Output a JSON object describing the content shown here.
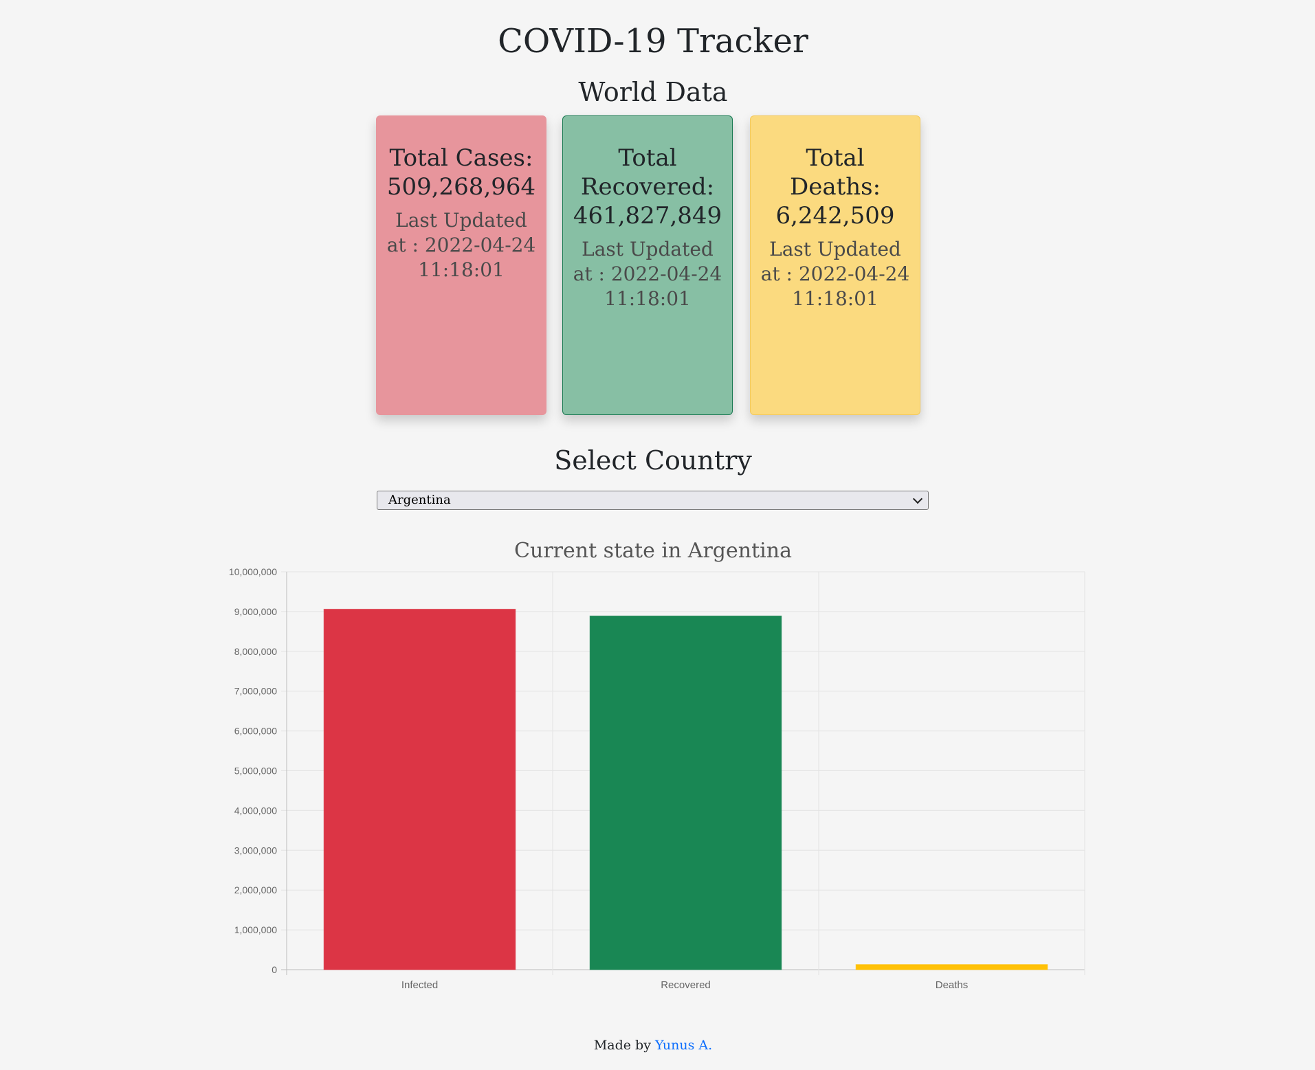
{
  "header": {
    "title": "COVID-19 Tracker",
    "subtitle": "World Data"
  },
  "cards": {
    "cases": {
      "heading": "Total Cases: 509,268,964",
      "updated": "Last Updated at : 2022-04-24 11:18:01",
      "color": "#e7959c"
    },
    "recovered": {
      "heading": "Total Recovered: 461,827,849",
      "updated": "Last Updated at : 2022-04-24 11:18:01",
      "color": "#87bfa4"
    },
    "deaths": {
      "heading": "Total Deaths: 6,242,509",
      "updated": "Last Updated at : 2022-04-24 11:18:01",
      "color": "#fbda7f"
    }
  },
  "country_selector": {
    "label": "Select Country",
    "selected": "Argentina"
  },
  "chart_data": {
    "type": "bar",
    "title": "Current state in Argentina",
    "categories": [
      "Infected",
      "Recovered",
      "Deaths"
    ],
    "values": [
      9060000,
      8890000,
      128000
    ],
    "colors": [
      "#dc3545",
      "#198754",
      "#ffc107"
    ],
    "ylim": [
      0,
      10000000
    ],
    "yticks": [
      "0",
      "1,000,000",
      "2,000,000",
      "3,000,000",
      "4,000,000",
      "5,000,000",
      "6,000,000",
      "7,000,000",
      "8,000,000",
      "9,000,000",
      "10,000,000"
    ],
    "grid": true
  },
  "footer": {
    "prefix": "Made by",
    "author": "Yunus A."
  }
}
